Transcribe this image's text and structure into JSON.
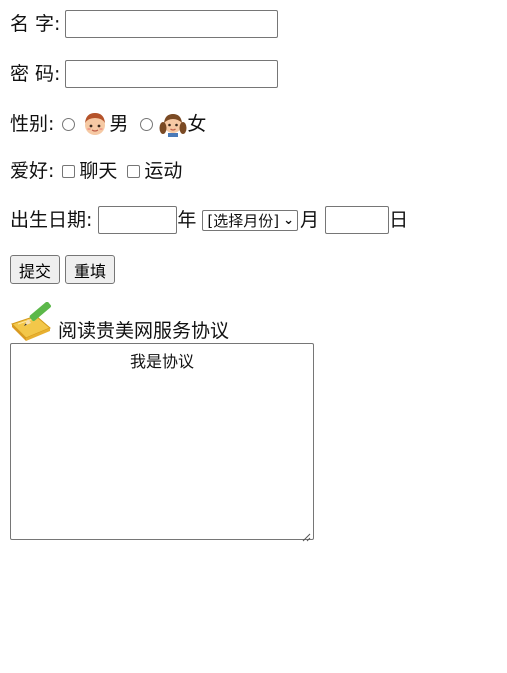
{
  "form": {
    "name_label": "名 字:",
    "password_label": "密 码:",
    "gender_label": "性别:",
    "gender_male": "男",
    "gender_female": "女",
    "hobby_label": "爱好:",
    "hobby_chat": "聊天",
    "hobby_sport": "运动",
    "birth_label": "出生日期:",
    "year_unit": "年",
    "month_select_value": "[选择月份]",
    "month_unit": "月",
    "day_unit": "日",
    "submit_label": "提交",
    "reset_label": "重填",
    "agreement_title": "阅读贵美网服务协议",
    "agreement_text": "我是协议"
  },
  "icons": {
    "male_avatar": "boy-avatar-icon",
    "female_avatar": "girl-avatar-icon",
    "agreement_icon": "pencil-notepad-icon",
    "select_arrow": "chevron-down-icon"
  }
}
